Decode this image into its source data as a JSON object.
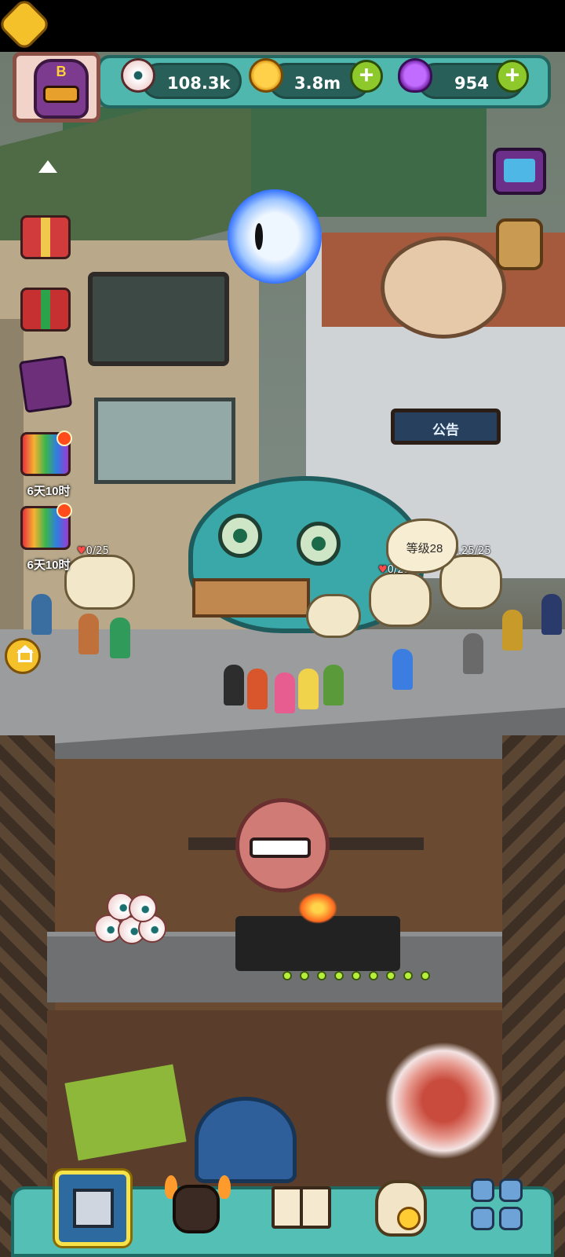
{
  "resources": {
    "eyeballs": {
      "icon": "eyeball-icon",
      "value": "108.3k"
    },
    "coins": {
      "icon": "coin-icon",
      "value": "3.8m",
      "add_label": "+"
    },
    "potions": {
      "icon": "potion-icon",
      "value": "954",
      "add_label": "+"
    }
  },
  "avatar": {
    "letter": "B"
  },
  "side_menu": {
    "timer_1": "6天10时",
    "timer_2": "6天10时"
  },
  "scene": {
    "notice_sign": "公告",
    "level_bubble": "等级28",
    "stalls": [
      {
        "likes": "0/25"
      },
      {
        "likes": "0/25"
      },
      {
        "likes": "0.25/25"
      }
    ]
  },
  "colors": {
    "hud_teal": "#4fb7ad",
    "plus_green": "#8ec92b",
    "nav_highlight": "#f7e24a"
  },
  "bottom_nav": {
    "items": [
      {
        "icon": "building-icon",
        "selected": true
      },
      {
        "icon": "monster-icon",
        "selected": false
      },
      {
        "icon": "book-icon",
        "selected": false
      },
      {
        "icon": "coin-sack-icon",
        "selected": false
      },
      {
        "icon": "grid-icon",
        "selected": false
      }
    ]
  }
}
